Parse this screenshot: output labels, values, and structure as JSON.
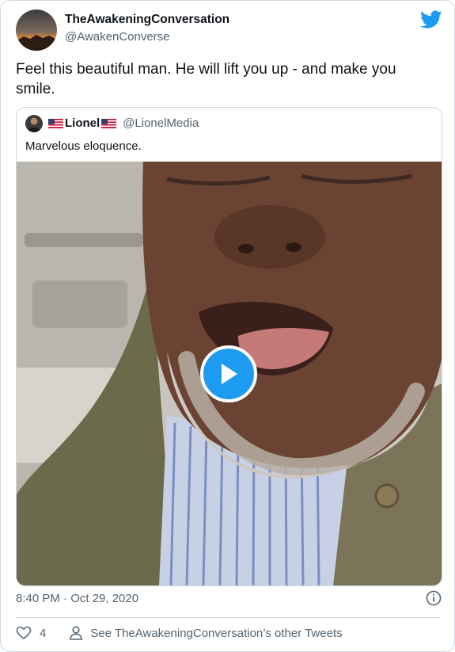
{
  "author": {
    "display_name": "TheAwakeningConversation",
    "handle": "@AwakenConverse"
  },
  "tweet": {
    "text": "Feel this beautiful man. He will lift you up - and make you smile.",
    "timestamp": "8:40 PM · Oct 29, 2020",
    "like_count": "4",
    "other_tweets_link": "See TheAwakeningConversation’s other Tweets"
  },
  "quoted_tweet": {
    "display_name": "Lionel",
    "handle": "@LionelMedia",
    "text": "Marvelous eloquence."
  },
  "icons": {
    "brand": "twitter-bird-icon",
    "play": "play-icon",
    "info": "info-icon",
    "like": "heart-icon",
    "profile": "person-icon"
  },
  "colors": {
    "accent": "#1d9bf0",
    "text_primary": "#0f1419",
    "text_secondary": "#536471",
    "border": "#cfd9de"
  }
}
